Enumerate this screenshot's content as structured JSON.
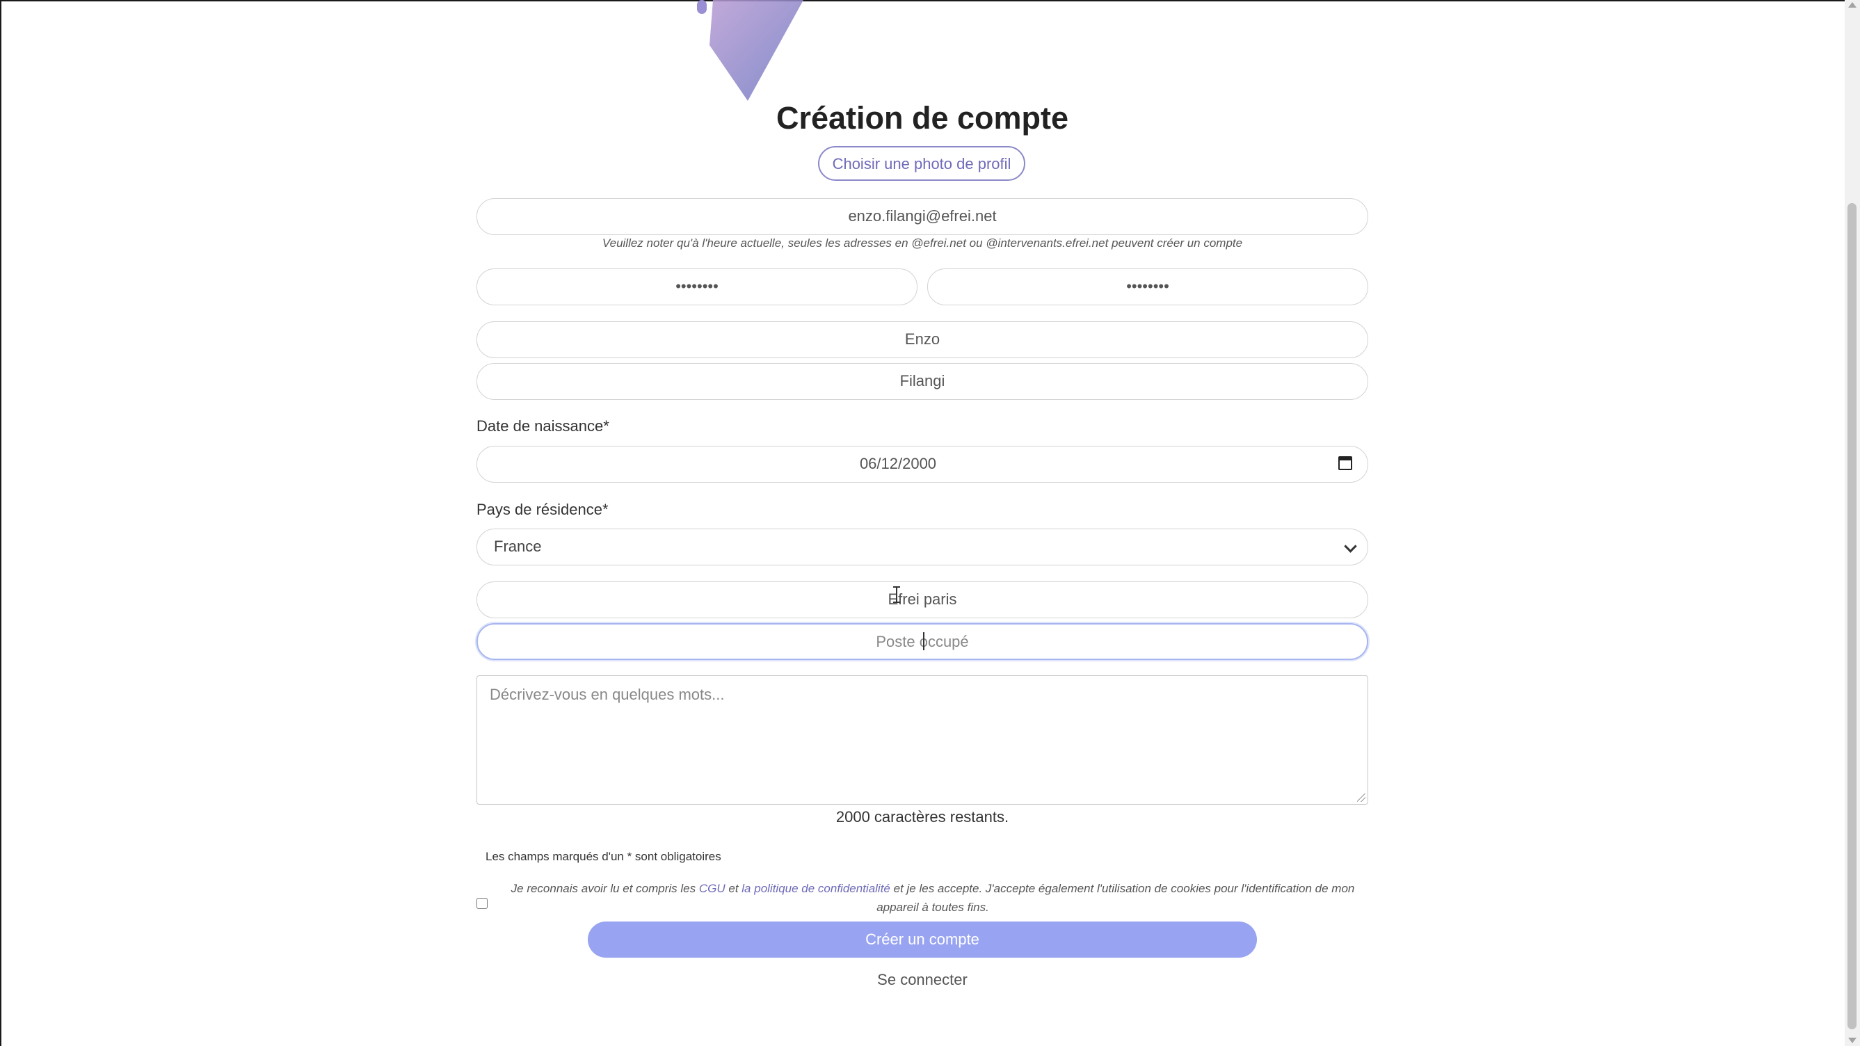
{
  "page": {
    "title": "Création de compte",
    "photo_button": "Choisir une photo de profil"
  },
  "form": {
    "email": {
      "value": "enzo.filangi@efrei.net"
    },
    "email_note": "Veuillez noter qu'à l'heure actuelle, seules les adresses en @efrei.net ou @intervenants.efrei.net peuvent créer un compte",
    "password": {
      "value": "••••••••"
    },
    "password_confirm": {
      "value": "••••••••"
    },
    "first_name": {
      "value": "Enzo"
    },
    "last_name": {
      "value": "Filangi"
    },
    "birth_date": {
      "label": "Date de naissance*",
      "value": "06/12/2000"
    },
    "country": {
      "label": "Pays de résidence*",
      "selected": "France"
    },
    "organization": {
      "value": "Efrei paris"
    },
    "position": {
      "placeholder": "Poste occupé"
    },
    "description": {
      "placeholder": "Décrivez-vous en quelques mots..."
    },
    "char_counter": "2000 caractères restants.",
    "required_note": "Les champs marqués d'un * sont obligatoires",
    "terms": {
      "part1": "Je reconnais avoir lu et compris les ",
      "cgu_link": "CGU",
      "part2": " et ",
      "privacy_link": "la politique de confidentialité",
      "part3": " et je les accepte. J'accepte également l'utilisation de cookies pour l'identification de mon appareil à toutes fins."
    },
    "submit_button": "Créer un compte",
    "login_link": "Se connecter"
  },
  "colors": {
    "accent": "#6e6ab8",
    "submit_bg": "#98a4f1",
    "logo_gradient": [
      "#a79ad6",
      "#6c78c2"
    ]
  }
}
